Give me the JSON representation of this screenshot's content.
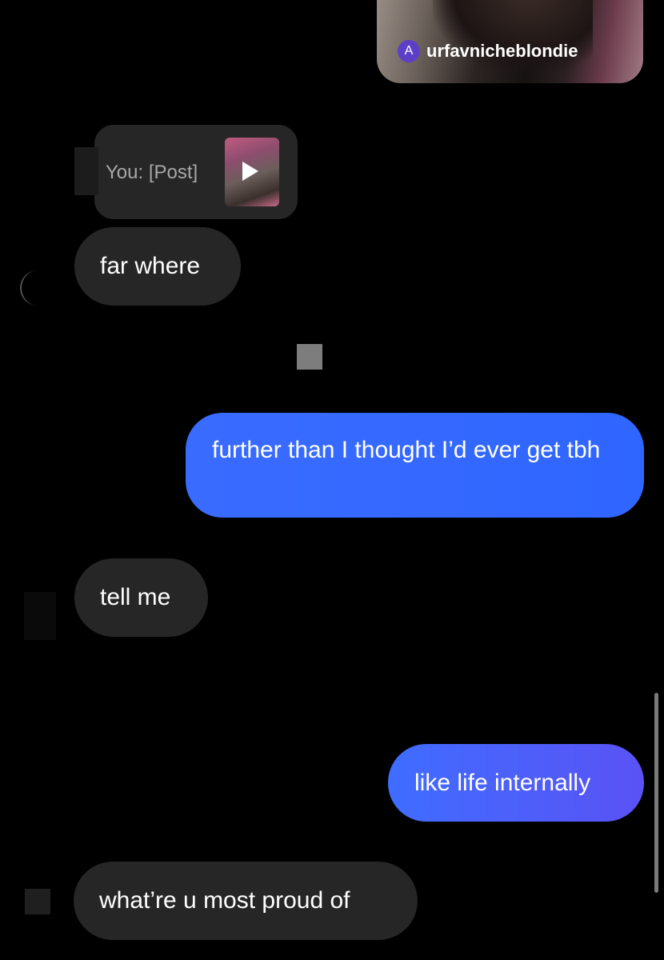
{
  "shared_post": {
    "author_initial": "A",
    "author_handle": "urfavnicheblondie"
  },
  "messages": [
    {
      "side": "in",
      "type": "post_reply",
      "text": "You: [Post]"
    },
    {
      "side": "in",
      "type": "text",
      "text": "far where"
    },
    {
      "side": "out",
      "type": "text",
      "text": "further than I thought I’d ever get tbh"
    },
    {
      "side": "in",
      "type": "text",
      "text": "tell me"
    },
    {
      "side": "out",
      "type": "text",
      "text": "like life internally"
    },
    {
      "side": "in",
      "type": "text",
      "text": "what’re u most proud of"
    }
  ],
  "colors": {
    "background": "#000000",
    "incoming_bubble": "#262626",
    "outgoing_bubble": "#3a6bff",
    "secondary_text": "#a8a8a8"
  },
  "icons": [
    "play-icon",
    "author-avatar"
  ]
}
